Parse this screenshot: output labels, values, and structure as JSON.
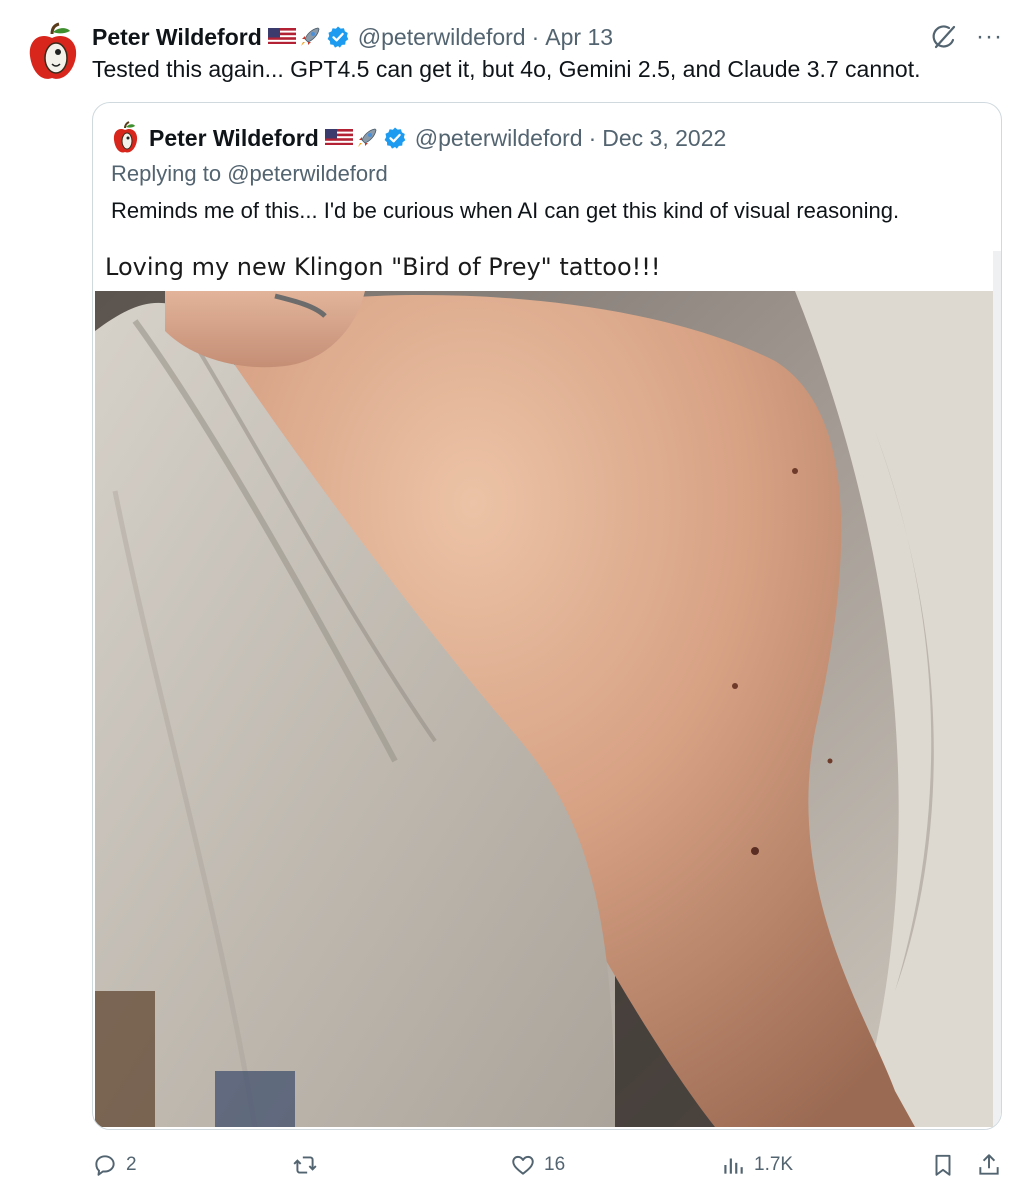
{
  "tweet": {
    "author_name": "Peter Wildeford",
    "handle": "@peterwildeford",
    "separator": "·",
    "date": "Apr 13",
    "text": "Tested this again... GPT4.5 can get it, but 4o, Gemini 2.5, and Claude 3.7 cannot.",
    "more_label": "···"
  },
  "quote": {
    "author_name": "Peter Wildeford",
    "handle": "@peterwildeford",
    "separator": "·",
    "date": "Dec 3, 2022",
    "replying_prefix": "Replying to ",
    "replying_handle": "@peterwildeford",
    "text": "Reminds me of this... I'd be curious when AI can get this kind of visual reasoning.",
    "media_caption": "Loving my new Klingon \"Bird of Prey\" tattoo!!!"
  },
  "actions": {
    "replies": "2",
    "reposts": "",
    "likes": "16",
    "views": "1.7K"
  },
  "icons": {
    "avatar": "apple-avatar-icon",
    "flag": "us-flag-icon",
    "rocket": "rocket-icon",
    "verified": "verified-badge-icon",
    "grok": "grok-icon",
    "reply": "reply-icon",
    "repost": "repost-icon",
    "like": "heart-icon",
    "views": "views-icon",
    "bookmark": "bookmark-icon",
    "share": "share-icon"
  },
  "colors": {
    "text_primary": "#0f1419",
    "text_secondary": "#536471",
    "verified_blue": "#1d9bf0",
    "border": "#cfd9de"
  }
}
